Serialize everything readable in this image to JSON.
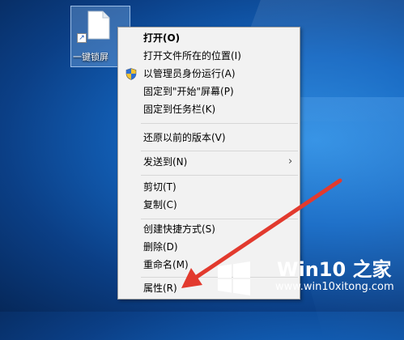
{
  "desktop_icon": {
    "label": "一键锁屏"
  },
  "context_menu": {
    "items": [
      {
        "label": "打开(O)"
      },
      {
        "label": "打开文件所在的位置(I)"
      },
      {
        "label": "以管理员身份运行(A)"
      },
      {
        "label": "固定到\"开始\"屏幕(P)"
      },
      {
        "label": "固定到任务栏(K)"
      },
      {
        "label": "还原以前的版本(V)"
      },
      {
        "label": "发送到(N)"
      },
      {
        "label": "剪切(T)"
      },
      {
        "label": "复制(C)"
      },
      {
        "label": "创建快捷方式(S)"
      },
      {
        "label": "删除(D)"
      },
      {
        "label": "重命名(M)"
      },
      {
        "label": "属性(R)"
      }
    ],
    "submenu_arrow": "›"
  },
  "watermark": {
    "brand": "Win10 之家",
    "url": "www.win10xitong.com"
  },
  "colors": {
    "desktop": "#1467c2",
    "annotation_arrow": "#e23a2e",
    "menu_bg": "#f2f2f2"
  }
}
